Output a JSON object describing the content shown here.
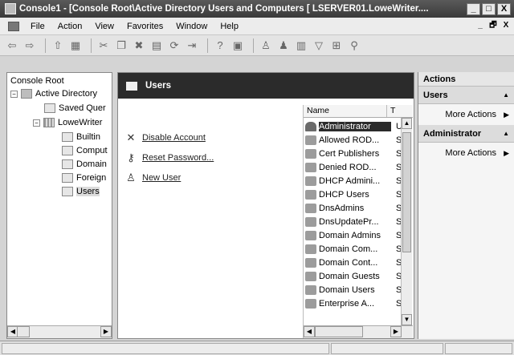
{
  "window": {
    "title": "Console1 - [Console Root\\Active Directory Users and Computers [ LSERVER01.LoweWriter....",
    "controls": {
      "minimize": "_",
      "maximize": "□",
      "close": "X"
    }
  },
  "menu": {
    "items": [
      "File",
      "Action",
      "View",
      "Favorites",
      "Window",
      "Help"
    ],
    "mdi_controls": {
      "minimize": "_",
      "restore": "🗗",
      "close": "X"
    }
  },
  "tree": {
    "items": [
      {
        "label": "Console Root",
        "expander": ""
      },
      {
        "label": "Active Directory",
        "expander": "−"
      },
      {
        "label": "Saved Quer",
        "expander": ""
      },
      {
        "label": "LoweWriter",
        "expander": "−"
      },
      {
        "label": "Builtin",
        "expander": ""
      },
      {
        "label": "Comput",
        "expander": ""
      },
      {
        "label": "Domain",
        "expander": ""
      },
      {
        "label": "Foreign",
        "expander": ""
      },
      {
        "label": "Users",
        "expander": ""
      }
    ]
  },
  "middle": {
    "header": "Users",
    "tasks": [
      {
        "label": "Disable Account",
        "icon": "x-icon",
        "glyph": "✕"
      },
      {
        "label": "Reset Password...",
        "icon": "key-icon",
        "glyph": "⚷"
      },
      {
        "label": "New User",
        "icon": "user-icon",
        "glyph": "♙"
      }
    ],
    "list": {
      "columns": [
        "Name",
        "T"
      ],
      "rows": [
        {
          "name": "Administrator",
          "type": "U"
        },
        {
          "name": "Allowed ROD...",
          "type": "S"
        },
        {
          "name": "Cert Publishers",
          "type": "S"
        },
        {
          "name": "Denied ROD...",
          "type": "S"
        },
        {
          "name": "DHCP Admini...",
          "type": "S"
        },
        {
          "name": "DHCP Users",
          "type": "S"
        },
        {
          "name": "DnsAdmins",
          "type": "S"
        },
        {
          "name": "DnsUpdatePr...",
          "type": "S"
        },
        {
          "name": "Domain Admins",
          "type": "S"
        },
        {
          "name": "Domain Com...",
          "type": "S"
        },
        {
          "name": "Domain Cont...",
          "type": "S"
        },
        {
          "name": "Domain Guests",
          "type": "S"
        },
        {
          "name": "Domain Users",
          "type": "S"
        },
        {
          "name": "Enterprise A...",
          "type": "S"
        }
      ]
    }
  },
  "actions": {
    "header": "Actions",
    "sections": [
      {
        "title": "Users",
        "item": "More Actions"
      },
      {
        "title": "Administrator",
        "item": "More Actions"
      }
    ]
  }
}
